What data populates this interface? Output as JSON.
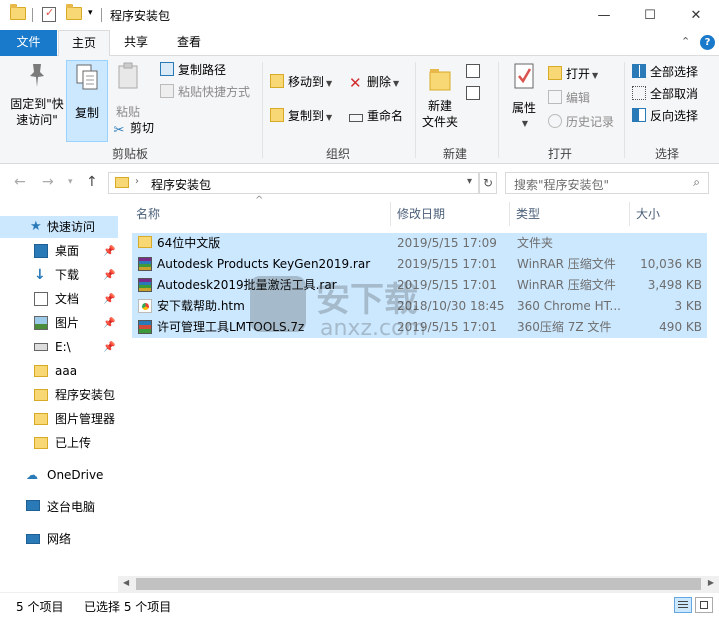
{
  "window": {
    "title": "程序安装包",
    "minimize": "—",
    "maximize": "☐",
    "close": "✕"
  },
  "tabs": {
    "file": "文件",
    "home": "主页",
    "share": "共享",
    "view": "查看",
    "collapse": "⌃",
    "help": "?"
  },
  "ribbon": {
    "clipboard": {
      "pin_quick": "固定到\"快\n速访问\"",
      "copy": "复制",
      "paste": "粘贴",
      "copy_path": "复制路径",
      "paste_shortcut": "粘贴快捷方式",
      "cut": "剪切",
      "label": "剪贴板"
    },
    "organize": {
      "move_to": "移动到",
      "copy_to": "复制到",
      "delete": "删除",
      "rename": "重命名",
      "label": "组织"
    },
    "new": {
      "new_folder": "新建\n文件夹",
      "label": "新建"
    },
    "open": {
      "properties": "属性",
      "open": "打开",
      "edit": "编辑",
      "history": "历史记录",
      "label": "打开"
    },
    "select": {
      "select_all": "全部选择",
      "select_none": "全部取消",
      "invert": "反向选择",
      "label": "选择"
    }
  },
  "address": {
    "path": "程序安装包",
    "search_placeholder": "搜索\"程序安装包\""
  },
  "navpane": {
    "items": [
      {
        "label": "快速访问",
        "icon": "star-icon",
        "pinned": false
      },
      {
        "label": "桌面",
        "icon": "desktop-icon",
        "pinned": true
      },
      {
        "label": "下载",
        "icon": "download-icon",
        "pinned": true
      },
      {
        "label": "文档",
        "icon": "document-icon",
        "pinned": true
      },
      {
        "label": "图片",
        "icon": "picture-icon",
        "pinned": true
      },
      {
        "label": "E:\\",
        "icon": "drive-icon",
        "pinned": true
      },
      {
        "label": "aaa",
        "icon": "folder-icon",
        "pinned": false
      },
      {
        "label": "程序安装包",
        "icon": "folder-icon",
        "pinned": false
      },
      {
        "label": "图片管理器",
        "icon": "folder-icon",
        "pinned": false
      },
      {
        "label": "已上传",
        "icon": "folder-icon",
        "pinned": false
      },
      {
        "label": "OneDrive",
        "icon": "cloud-icon",
        "pinned": false
      },
      {
        "label": "这台电脑",
        "icon": "computer-icon",
        "pinned": false
      },
      {
        "label": "网络",
        "icon": "network-icon",
        "pinned": false
      }
    ]
  },
  "columns": {
    "name": "名称",
    "date": "修改日期",
    "type": "类型",
    "size": "大小"
  },
  "files": [
    {
      "name": "64位中文版",
      "date": "2019/5/15 17:09",
      "type": "文件夹",
      "size": "",
      "icon": "folder-icon"
    },
    {
      "name": "Autodesk Products KeyGen2019.rar",
      "date": "2019/5/15 17:01",
      "type": "WinRAR 压缩文件",
      "size": "10,036 KB",
      "icon": "rar-icon"
    },
    {
      "name": "Autodesk2019批量激活工具.rar",
      "date": "2019/5/15 17:01",
      "type": "WinRAR 压缩文件",
      "size": "3,498 KB",
      "icon": "rar-icon"
    },
    {
      "name": "安下载帮助.htm",
      "date": "2018/10/30 18:45",
      "type": "360 Chrome HT...",
      "size": "3 KB",
      "icon": "chrome-html-icon"
    },
    {
      "name": "许可管理工具LMTOOLS.7z",
      "date": "2019/5/15 17:01",
      "type": "360压缩 7Z 文件",
      "size": "490 KB",
      "icon": "7z-icon"
    }
  ],
  "status": {
    "count": "5 个项目",
    "selected": "已选择 5 个项目"
  },
  "watermark": {
    "text": "安下载",
    "url": "anxz.com"
  }
}
